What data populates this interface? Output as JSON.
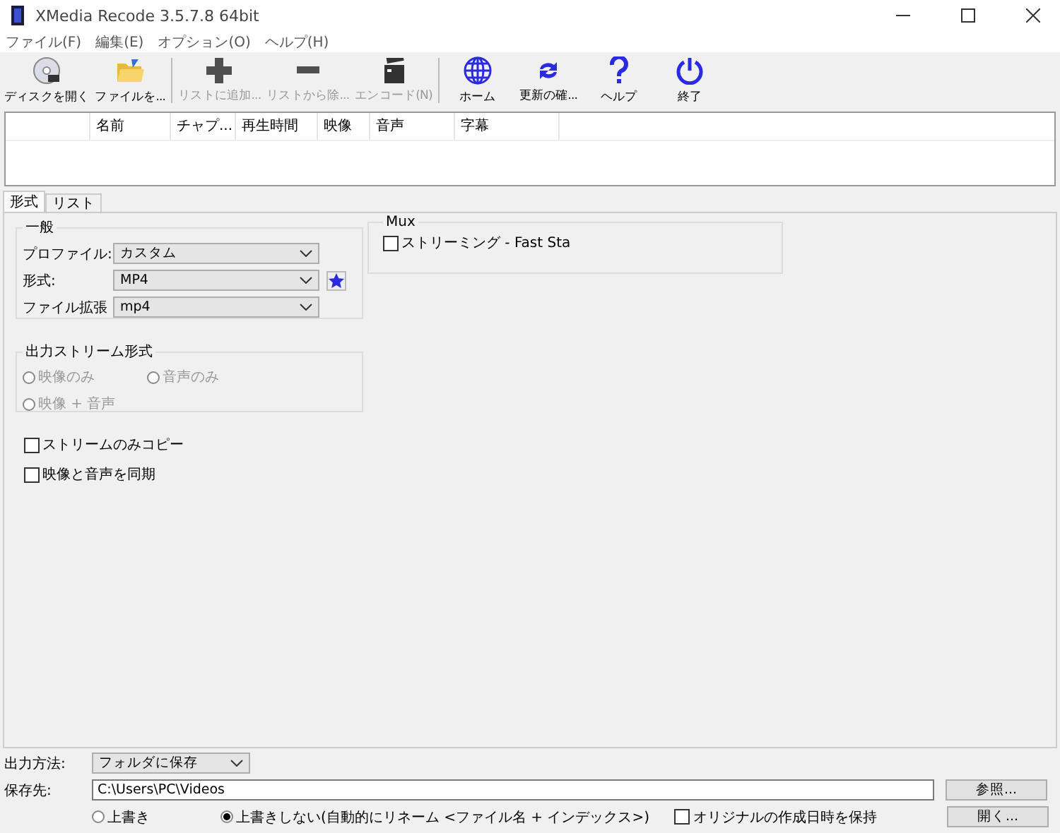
{
  "window": {
    "title": "XMedia Recode 3.5.7.8 64bit"
  },
  "menu": [
    "ファイル(F)",
    "編集(E)",
    "オプション(O)",
    "ヘルプ(H)"
  ],
  "toolbar": [
    [
      {
        "label": "ディスクを開く",
        "disabled": false
      },
      {
        "label": "ファイルを...",
        "disabled": false
      }
    ],
    [
      {
        "label": "リストに追加...",
        "disabled": true
      },
      {
        "label": "リストから除...",
        "disabled": true
      },
      {
        "label": "エンコード(N)",
        "disabled": true
      }
    ],
    [
      {
        "label": "ホーム",
        "disabled": false
      },
      {
        "label": "更新の確...",
        "disabled": false
      },
      {
        "label": "ヘルプ",
        "disabled": false
      },
      {
        "label": "終了",
        "disabled": false
      }
    ]
  ],
  "file_list": {
    "columns": [
      "名前",
      "チャプ...",
      "再生時間",
      "映像",
      "音声",
      "字幕"
    ]
  },
  "tabs": [
    {
      "label": "形式",
      "selected": true
    },
    {
      "label": "リスト",
      "selected": false
    }
  ],
  "general": {
    "title": "一般",
    "fields": [
      {
        "label": "プロファイル:",
        "value": "カスタム"
      },
      {
        "label": "形式:",
        "value": "MP4"
      },
      {
        "label": "ファイル拡張",
        "value": "mp4"
      }
    ]
  },
  "mux": {
    "title": "Mux",
    "option": {
      "label": "ストリーミング - Fast Sta",
      "checked": false
    }
  },
  "output_stream": {
    "title": "出力ストリーム形式",
    "options": [
      {
        "label": "映像のみ",
        "selected": false,
        "disabled": true
      },
      {
        "label": "音声のみ",
        "selected": false,
        "disabled": true
      },
      {
        "label": "映像 + 音声",
        "selected": false,
        "disabled": true
      }
    ]
  },
  "options": [
    {
      "label": "ストリームのみコピー",
      "checked": false
    },
    {
      "label": "映像と音声を同期",
      "checked": false
    }
  ],
  "output": {
    "method_label": "出力方法:",
    "method": "フォルダに保存",
    "dest_label": "保存先:",
    "dest": "C:\\Users\\PC\\Videos",
    "browse": "参照...",
    "open": "開く...",
    "modes": [
      {
        "label": "上書き",
        "selected": false
      },
      {
        "label": "上書きしない(自動的にリネーム <ファイル名 + インデックス>)",
        "selected": true
      }
    ],
    "keep_date": {
      "label": "オリジナルの作成日時を保持",
      "checked": false
    }
  }
}
